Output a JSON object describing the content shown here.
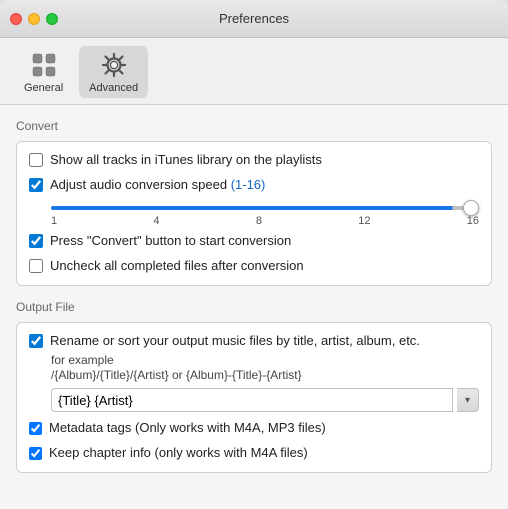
{
  "window": {
    "title": "Preferences"
  },
  "toolbar": {
    "buttons": [
      {
        "id": "general",
        "label": "General",
        "active": false
      },
      {
        "id": "advanced",
        "label": "Advanced",
        "active": true
      }
    ]
  },
  "convert_section": {
    "title": "Convert",
    "options": [
      {
        "id": "show_all_tracks",
        "checked": false,
        "label": "Show all tracks in iTunes library on the playlists"
      },
      {
        "id": "adjust_speed",
        "checked": true,
        "label": "Adjust audio conversion speed (1-16)"
      },
      {
        "id": "press_convert",
        "checked": true,
        "label": "Press \"Convert\" button to start conversion"
      },
      {
        "id": "uncheck_completed",
        "checked": false,
        "label": "Uncheck all completed files after conversion"
      }
    ],
    "slider": {
      "min": 1,
      "max": 16,
      "value": 16,
      "ticks": [
        "1",
        "4",
        "8",
        "12",
        "16"
      ]
    }
  },
  "output_section": {
    "title": "Output File",
    "rename_checked": true,
    "rename_label": "Rename or sort your output music files by title, artist, album, etc.",
    "example_label": "for example",
    "example_path": "/{Album}/{Title}/{Artist} or {Album}-{Title}-{Artist}",
    "input_value": "{Title} {Artist}",
    "metadata_checked": true,
    "metadata_label": "Metadata tags (Only works with M4A, MP3 files)",
    "chapter_checked": true,
    "chapter_label": "Keep chapter info (only works with  M4A files)",
    "dropdown_icon": "▾"
  }
}
